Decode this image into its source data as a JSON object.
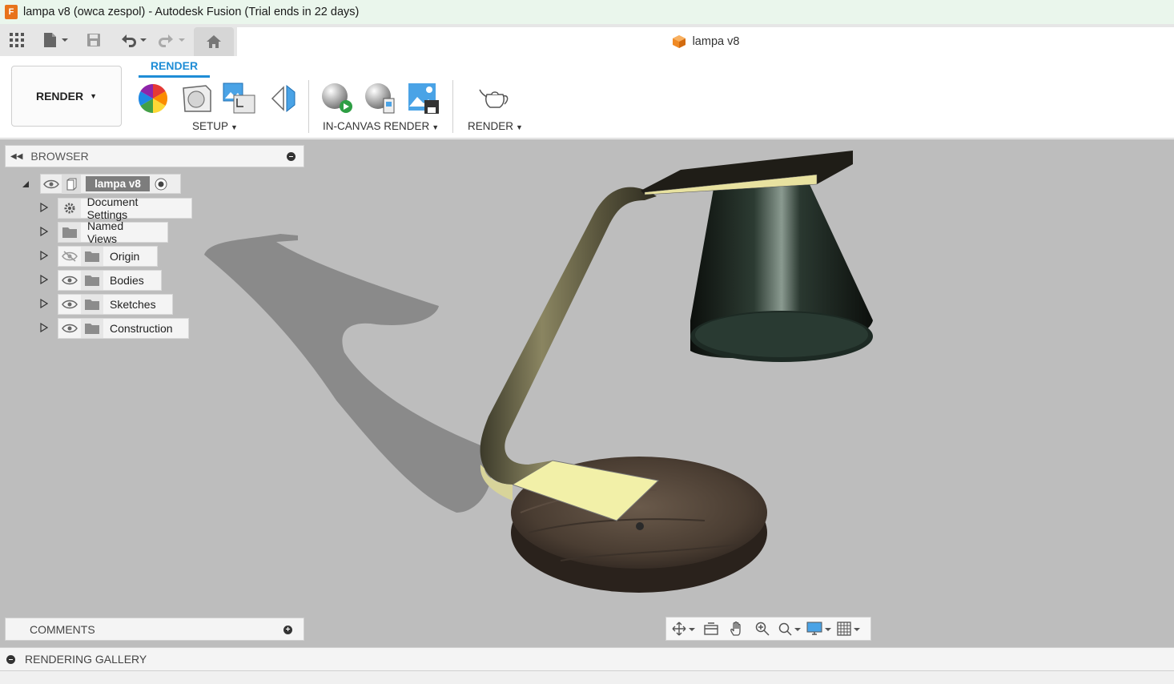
{
  "window": {
    "title": "lampa v8 (owca zespol) - Autodesk Fusion (Trial ends in 22 days)",
    "app_icon_letter": "F"
  },
  "document_tab": {
    "name": "lampa v8"
  },
  "toolbar": {
    "workspace_label": "RENDER",
    "active_tab": "RENDER",
    "groups": {
      "setup": "SETUP",
      "in_canvas": "IN-CANVAS RENDER",
      "render": "RENDER"
    }
  },
  "browser": {
    "header": "BROWSER",
    "root": "lampa v8",
    "items": [
      {
        "label": "Document Settings"
      },
      {
        "label": "Named Views"
      },
      {
        "label": "Origin"
      },
      {
        "label": "Bodies"
      },
      {
        "label": "Sketches"
      },
      {
        "label": "Construction"
      }
    ]
  },
  "comments": {
    "label": "COMMENTS"
  },
  "gallery": {
    "label": "RENDERING GALLERY"
  },
  "colors": {
    "accent": "#1f8dd6",
    "viewport_bg": "#bdbdbd",
    "title_bg": "#eaf6ec"
  }
}
